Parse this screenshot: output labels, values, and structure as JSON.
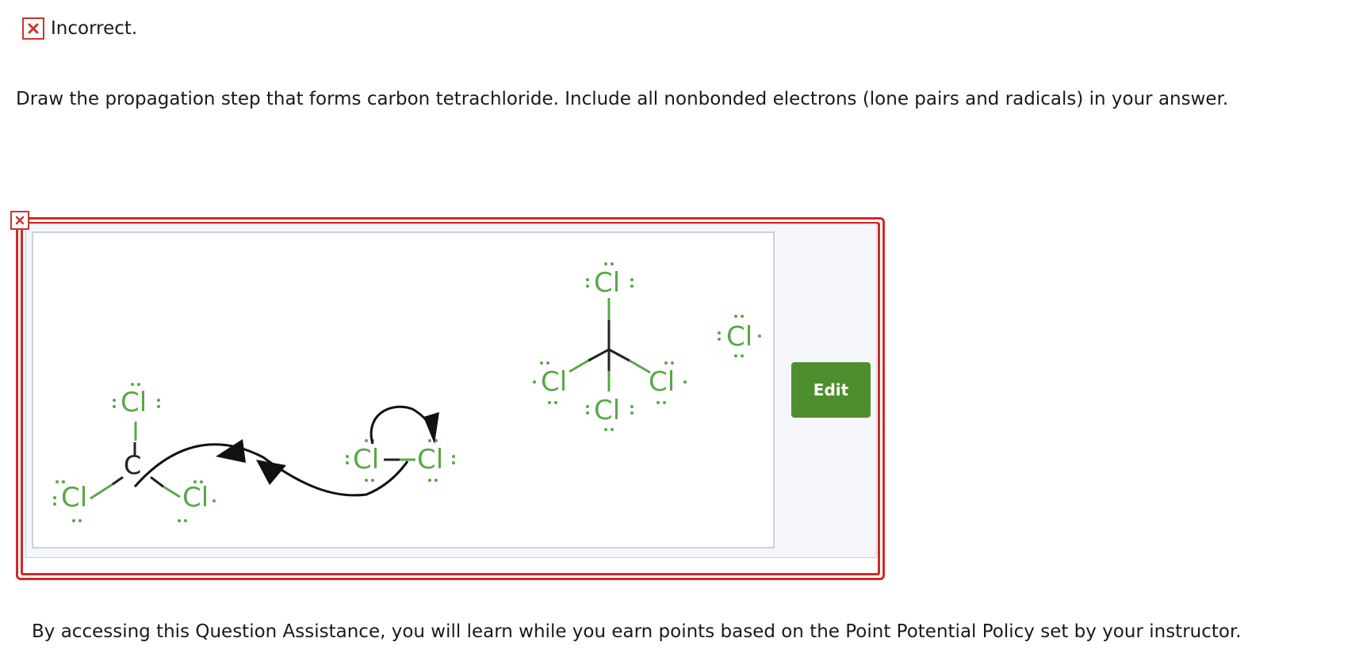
{
  "status": {
    "icon": "x-icon",
    "text": "Incorrect."
  },
  "question": {
    "text": "Draw the propagation step that forms carbon tetrachloride. Include all nonbonded electrons (lone pairs and radicals) in your answer."
  },
  "answer": {
    "error_icon": "x-icon",
    "edit_label": "Edit",
    "atom_cl": "Cl",
    "atom_c": "C"
  },
  "footer": {
    "text": "By accessing this Question Assistance, you will learn while you earn points based on the Point Potential Policy set by your instructor."
  },
  "colors": {
    "error_red": "#d02a2a",
    "atom_green": "#57a845",
    "edit_green": "#4f8e2f"
  }
}
